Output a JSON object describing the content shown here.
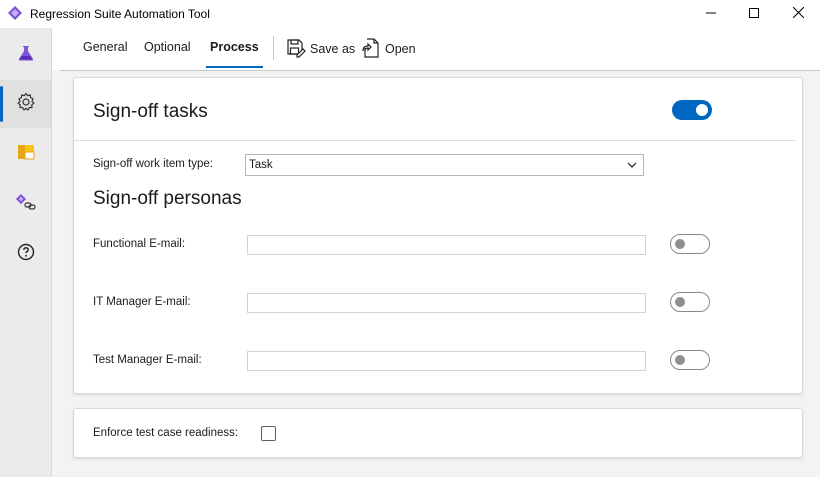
{
  "window": {
    "title": "Regression Suite Automation Tool",
    "app_icon": "purple-diamond-icon",
    "controls": [
      "minimize-icon",
      "maximize-icon",
      "close-icon"
    ]
  },
  "sidebar": {
    "items": [
      {
        "name": "flask-icon",
        "active": false
      },
      {
        "name": "gear-icon",
        "active": true
      },
      {
        "name": "boards-icon",
        "active": false
      },
      {
        "name": "link-icon",
        "active": false
      },
      {
        "name": "help-icon",
        "active": false
      }
    ]
  },
  "tabs": {
    "general": "General",
    "optional": "Optional",
    "process": "Process",
    "active": "Process"
  },
  "toolbar": {
    "save_as": "Save as",
    "open": "Open"
  },
  "signoff": {
    "heading": "Sign-off tasks",
    "enabled": true,
    "work_item_type_label": "Sign-off work item type:",
    "work_item_type_value": "Task"
  },
  "personas": {
    "heading": "Sign-off personas",
    "functional_label": "Functional E-mail:",
    "functional_value": "",
    "it_manager_label": "IT Manager E-mail:",
    "it_manager_value": "",
    "test_manager_label": "Test Manager E-mail:",
    "test_manager_value": ""
  },
  "readiness": {
    "label": "Enforce test case readiness:",
    "checked": false
  },
  "colors": {
    "accent": "#0067c0",
    "background": "#f3f3f3"
  }
}
